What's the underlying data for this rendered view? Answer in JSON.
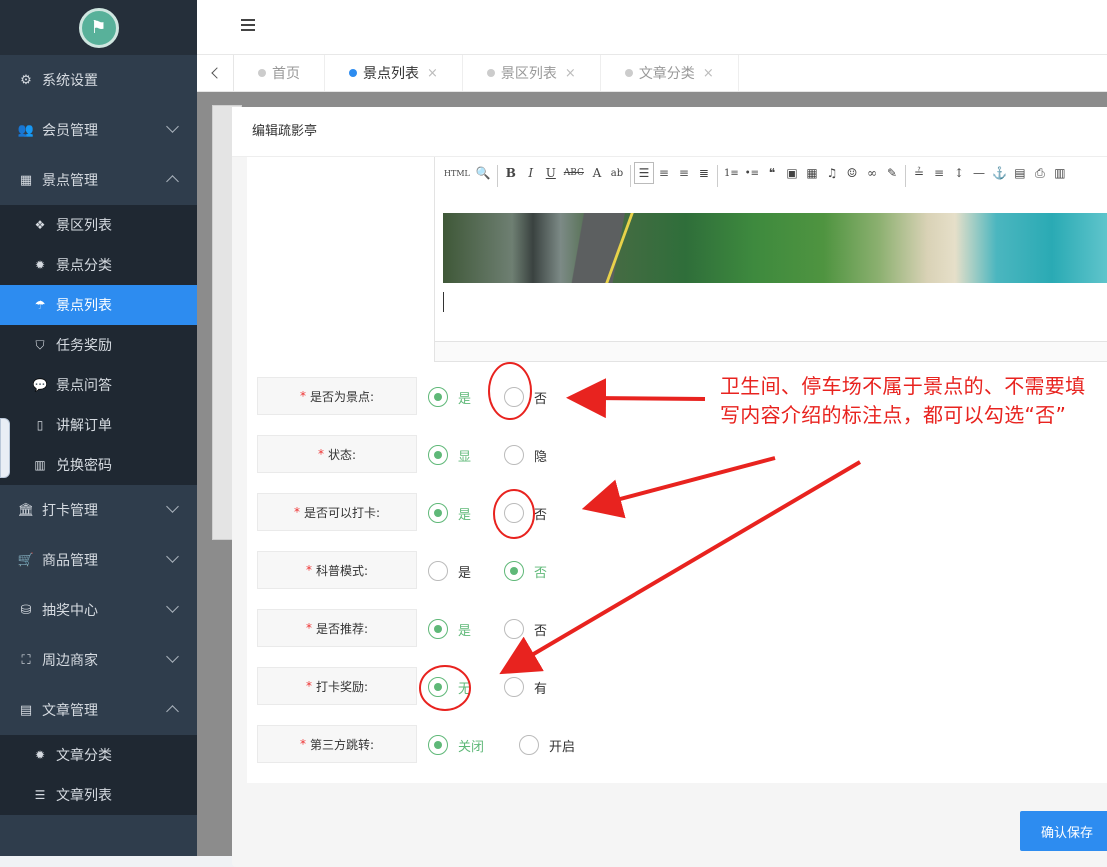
{
  "sidebar": {
    "items": [
      {
        "label": "系统设置",
        "icon": "gears-icon"
      },
      {
        "label": "会员管理",
        "icon": "users-icon"
      },
      {
        "label": "景点管理",
        "icon": "grid-icon"
      },
      {
        "label": "打卡管理",
        "icon": "bank-icon"
      },
      {
        "label": "商品管理",
        "icon": "cart-icon"
      },
      {
        "label": "抽奖中心",
        "icon": "database-icon"
      },
      {
        "label": "周边商家",
        "icon": "sitemap-icon"
      },
      {
        "label": "文章管理",
        "icon": "newspaper-icon"
      }
    ],
    "spot_sub": [
      {
        "label": "景区列表",
        "icon": "cubes-icon"
      },
      {
        "label": "景点分类",
        "icon": "gear-icon"
      },
      {
        "label": "景点列表",
        "icon": "umbrella-icon"
      },
      {
        "label": "任务奖励",
        "icon": "shield-icon"
      },
      {
        "label": "景点问答",
        "icon": "comment-icon"
      },
      {
        "label": "讲解订单",
        "icon": "file-icon"
      },
      {
        "label": "兑换密码",
        "icon": "barcode-icon"
      }
    ],
    "article_sub": [
      {
        "label": "文章分类",
        "icon": "gear-icon"
      },
      {
        "label": "文章列表",
        "icon": "list-icon"
      }
    ]
  },
  "tabs": [
    {
      "label": "首页"
    },
    {
      "label": "景点列表"
    },
    {
      "label": "景区列表"
    },
    {
      "label": "文章分类"
    }
  ],
  "tab_close": "×",
  "modal": {
    "title": "编辑疏影亭",
    "save_label": "确认保存"
  },
  "editor": {
    "toolbar": [
      "HTML",
      "B",
      "I",
      "U",
      "ABC",
      "A",
      "ab",
      "☰",
      "≡",
      "≡",
      "≣",
      "1≡",
      "•≡",
      "❝",
      "▣",
      "▦",
      "♫",
      "☺",
      "∞",
      "✎",
      "≟",
      "≡",
      "↕"
    ],
    "toolbar2": [
      "—",
      "⚓",
      "▤",
      "⎙",
      "▥"
    ]
  },
  "form": [
    {
      "label": "是否为景点:",
      "options": [
        "是",
        "否"
      ],
      "selected": 0
    },
    {
      "label": "状态:",
      "options": [
        "显",
        "隐"
      ],
      "selected": 0
    },
    {
      "label": "是否可以打卡:",
      "options": [
        "是",
        "否"
      ],
      "selected": 0
    },
    {
      "label": "科普模式:",
      "options": [
        "是",
        "否"
      ],
      "selected": 1
    },
    {
      "label": "是否推荐:",
      "options": [
        "是",
        "否"
      ],
      "selected": 0
    },
    {
      "label": "打卡奖励:",
      "options": [
        "无",
        "有"
      ],
      "selected": 0
    },
    {
      "label": "第三方跳转:",
      "options": [
        "关闭",
        "开启"
      ],
      "selected": 0
    }
  ],
  "required_mark": "*",
  "annotation": {
    "line1": "卫生间、停车场不属于景点的、不需要填",
    "line2": "写内容介绍的标注点，都可以勾选“否”"
  },
  "colors": {
    "accent": "#2d8cf0",
    "radio_on": "#5fb878",
    "annotation": "#e8231f"
  }
}
